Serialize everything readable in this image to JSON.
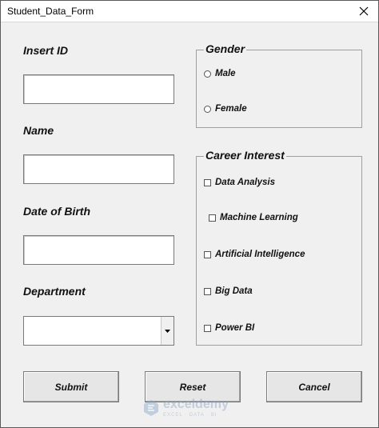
{
  "window": {
    "title": "Student_Data_Form"
  },
  "fields": {
    "insert_id": {
      "label": "Insert ID",
      "value": ""
    },
    "name": {
      "label": "Name",
      "value": ""
    },
    "dob": {
      "label": "Date of Birth",
      "value": ""
    },
    "department": {
      "label": "Department",
      "value": ""
    }
  },
  "gender": {
    "legend": "Gender",
    "options": [
      "Male",
      "Female"
    ]
  },
  "career": {
    "legend": "Career Interest",
    "options": [
      "Data Analysis",
      "Machine Learning",
      "Artificial Intelligence",
      "Big Data",
      "Power BI"
    ]
  },
  "buttons": {
    "submit": "Submit",
    "reset": "Reset",
    "cancel": "Cancel"
  },
  "watermark": {
    "name": "exceldemy",
    "tagline": "EXCEL · DATA · BI",
    "color": "#8aa6c8"
  },
  "icons": {
    "close": "close-icon",
    "dropdown": "chevron-down-icon",
    "logo": "exceldemy-logo-icon"
  }
}
